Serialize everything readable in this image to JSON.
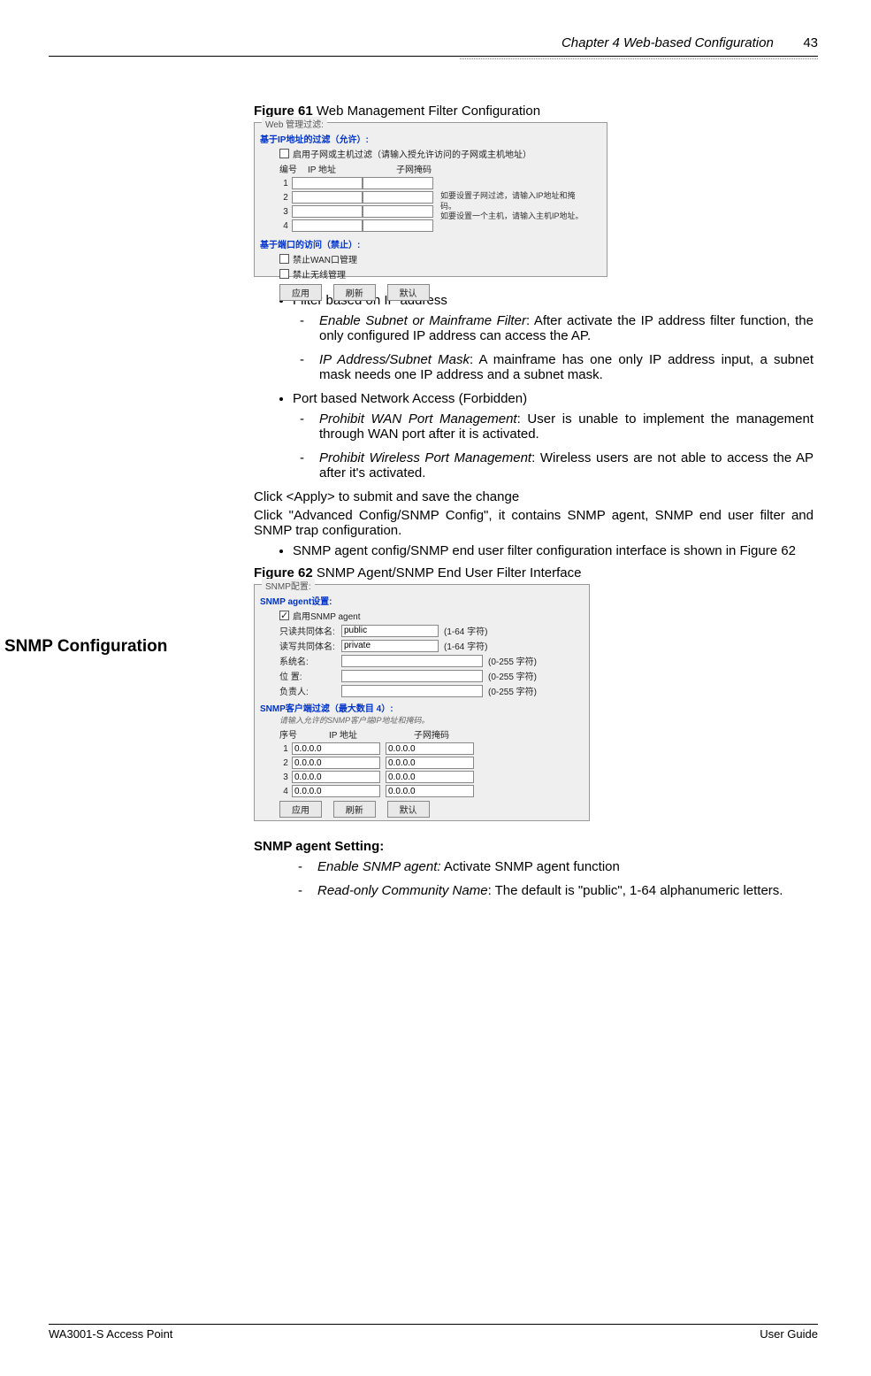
{
  "header": {
    "chapter": "Chapter 4 Web-based Configuration",
    "page": "43"
  },
  "fig61": {
    "caption_label": "Figure 61",
    "caption_text": " Web Management Filter Configuration",
    "panel_title": "Web 管理过滤:",
    "ip_filter_title": "基于IP地址的过滤（允许）:",
    "enable_subnet_label": "启用子网或主机过滤（请输入授允许访问的子网或主机地址）",
    "col_num": "编号",
    "col_ip": "IP 地址",
    "col_mask": "子网掩码",
    "rows": [
      "1",
      "2",
      "3",
      "4"
    ],
    "hint1": "如要设置子网过滤，请输入IP地址和掩码。",
    "hint2": "如要设置一个主机，请输入主机IP地址。",
    "port_title": "基于端口的访问（禁止）:",
    "wan_label": "禁止WAN口管理",
    "wlan_label": "禁止无线管理",
    "btn_apply": "应用",
    "btn_refresh": "刷新",
    "btn_default": "默认"
  },
  "bullets": {
    "b1": "Filter based on IP address",
    "b1a_t": "Enable Subnet or Mainframe Filter",
    "b1a_d": ": After activate the IP address filter function, the only configured IP address can access the AP.",
    "b1b_t": "IP Address/Subnet Mask",
    "b1b_d": ": A mainframe has one only IP address input, a subnet mask needs one IP address and a subnet mask.",
    "b2": "Port based Network Access (Forbidden)",
    "b2a_t": "Prohibit WAN Port Management",
    "b2a_d": ": User is unable to implement the management through WAN port after it is activated.",
    "b2b_t": "Prohibit Wireless Port Management",
    "b2b_d": ": Wireless users are not able to access the AP after it's activated.",
    "apply": "Click <Apply> to submit and save the change"
  },
  "snmp": {
    "heading": "SNMP Configuration",
    "intro": "Click \"Advanced Config/SNMP Config\", it contains SNMP agent, SNMP end user filter and SNMP trap configuration.",
    "b1": "SNMP agent config/SNMP end user filter configuration interface is shown in Figure 62"
  },
  "fig62": {
    "caption_label": "Figure 62",
    "caption_text": " SNMP Agent/SNMP End User Filter Interface",
    "panel_title": "SNMP配置:",
    "agent_title": "SNMP agent设置:",
    "enable_label": "启用SNMP agent",
    "ro_label": "只读共同体名:",
    "ro_value": "public",
    "ro_hint": "(1-64 字符)",
    "rw_label": "读写共同体名:",
    "rw_value": "private",
    "rw_hint": "(1-64 字符)",
    "sys_label": "系统名:",
    "sys_hint": "(0-255 字符)",
    "loc_label": "位 置:",
    "loc_hint": "(0-255 字符)",
    "con_label": "负责人:",
    "con_hint": "(0-255 字符)",
    "client_title": "SNMP客户端过滤（最大数目 4）:",
    "client_hint": "请输入允许的SNMP客户端IP地址和掩码。",
    "col_num": "序号",
    "col_ip": "IP 地址",
    "col_mask": "子网掩码",
    "rows": [
      {
        "n": "1",
        "ip": "0.0.0.0",
        "mask": "0.0.0.0"
      },
      {
        "n": "2",
        "ip": "0.0.0.0",
        "mask": "0.0.0.0"
      },
      {
        "n": "3",
        "ip": "0.0.0.0",
        "mask": "0.0.0.0"
      },
      {
        "n": "4",
        "ip": "0.0.0.0",
        "mask": "0.0.0.0"
      }
    ],
    "btn_apply": "应用",
    "btn_refresh": "刷新",
    "btn_default": "默认"
  },
  "snmp_text": {
    "heading": "SNMP agent Setting:",
    "a_t": "Enable SNMP agent:",
    "a_d": " Activate SNMP agent function",
    "b_t": "Read-only Community Name",
    "b_d": ": The default is \"public\", 1-64 alphanumeric letters."
  },
  "footer": {
    "left": "WA3001-S Access Point",
    "right": "User Guide"
  }
}
